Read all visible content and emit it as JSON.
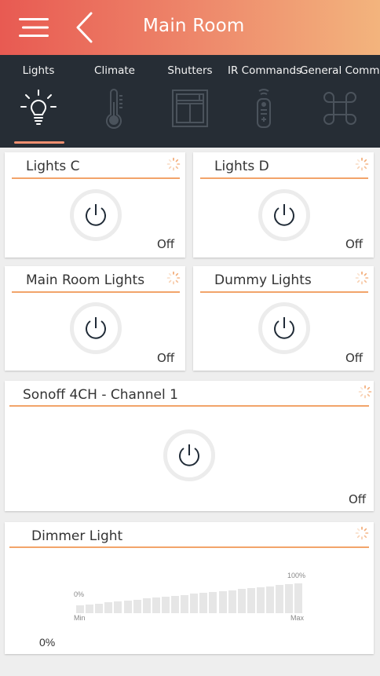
{
  "header": {
    "title": "Main Room",
    "bg_colors": [
      "#e85a52",
      "#f3b47d"
    ]
  },
  "tabs": [
    {
      "label": "Lights",
      "icon": "lightbulb-icon",
      "active": true
    },
    {
      "label": "Climate",
      "icon": "thermometer-icon"
    },
    {
      "label": "Shutters",
      "icon": "window-shutter-icon"
    },
    {
      "label": "IR Commands",
      "icon": "remote-control-icon"
    },
    {
      "label": "General Commands",
      "icon": "command-key-icon"
    }
  ],
  "cards": [
    {
      "title": "Lights C",
      "state": "Off"
    },
    {
      "title": "Lights D",
      "state": "Off"
    },
    {
      "title": "Main Room Lights",
      "state": "Off"
    },
    {
      "title": "Dummy Lights",
      "state": "Off"
    },
    {
      "title": "Sonoff 4CH - Channel 1",
      "state": "Off"
    }
  ],
  "dimmer": {
    "title": "Dimmer Light",
    "min_label": "Min",
    "max_label": "Max",
    "zero_label": "0%",
    "hundred_label": "100%",
    "value": "0%",
    "level": 0
  },
  "colors": {
    "accent": "#f2a46a",
    "tab_bg": "#262d35",
    "power_stroke": "#1f2a36"
  }
}
